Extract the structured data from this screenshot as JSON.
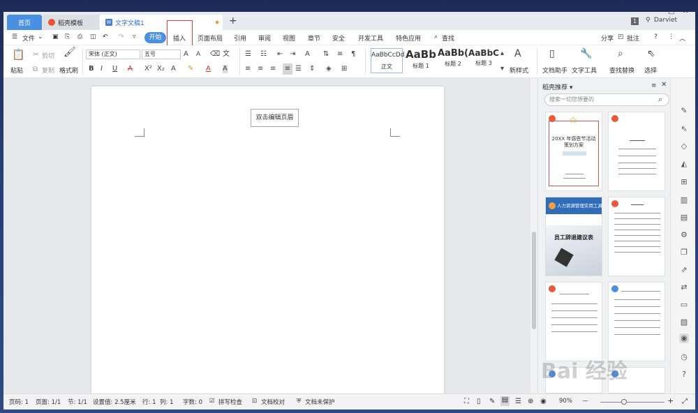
{
  "tabs": {
    "home": "首页",
    "template": "稻壳模板",
    "document": "文字文稿1",
    "new_tab": "+"
  },
  "window": {
    "badge": "1",
    "user": "Darviet",
    "minimize": "—",
    "maximize": "□",
    "close": "✕"
  },
  "menu": {
    "file": "文件",
    "start": "开始",
    "insert": "插入",
    "layout": "页面布局",
    "references": "引用",
    "review": "审阅",
    "view": "视图",
    "section": "章节",
    "security": "安全",
    "developer": "开发工具",
    "special": "特色应用",
    "search": "查找",
    "share": "分享",
    "comment": "批注",
    "help": "?"
  },
  "ribbon": {
    "paste": "粘贴",
    "cut": "剪切",
    "copy": "复制",
    "format_painter": "格式刷",
    "font_name": "宋体 (正文)",
    "font_size": "五号",
    "styles": [
      {
        "preview": "AaBbCcDd",
        "label": "正文"
      },
      {
        "preview": "AaBb",
        "label": "标题 1"
      },
      {
        "preview": "AaBb(",
        "label": "标题 2"
      },
      {
        "preview": "AaBbC",
        "label": "标题 3"
      }
    ],
    "new_style": "新样式",
    "doc_assistant": "文档助手",
    "text_tools": "文字工具",
    "find_replace": "查找替换",
    "select": "选择"
  },
  "document": {
    "header_hint": "双击编辑页眉"
  },
  "panel": {
    "title": "稻壳推荐",
    "search_placeholder": "搜索一切您想要的",
    "card1_title": "20XX 年感恩节活动策划方案",
    "card3_banner": "人力资源管理实用工具",
    "card3_title": "员工辞退建议表"
  },
  "status": {
    "page": "页码: 1",
    "pages": "页面: 1/1",
    "section": "节: 1/1",
    "setting": "设置值: 2.5厘米",
    "row": "行: 1",
    "col": "列: 1",
    "words": "字数: 0",
    "spell": "拼写检查",
    "proof": "文档校对",
    "protect": "文档未保护",
    "zoom": "90%",
    "zoom_minus": "—",
    "zoom_plus": "+"
  },
  "watermark": "Bai 经验",
  "colors": {
    "accent": "#4a90e2",
    "highlight_box": "#e53935",
    "brand_red": "#ea5a36"
  }
}
